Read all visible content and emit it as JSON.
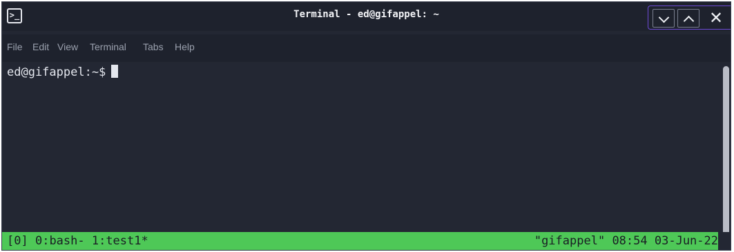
{
  "window": {
    "title": "Terminal - ed@gifappel: ~",
    "app_icon": "terminal-icon",
    "controls": {
      "minimize_icon": "chevron-down-icon",
      "maximize_icon": "chevron-up-icon",
      "close_label": "✕"
    }
  },
  "menu": {
    "items": [
      "File",
      "Edit",
      "View",
      "Terminal",
      "Tabs",
      "Help"
    ]
  },
  "terminal": {
    "prompt": "ed@gifappel:~$",
    "background": "#232733",
    "foreground": "#e4e7ee"
  },
  "statusbar": {
    "session": "[0]",
    "windows": "0:bash- 1:test1*",
    "host": "\"gifappel\"",
    "time": "08:54",
    "date": "03-Jun-22",
    "color": "#4ec857"
  }
}
